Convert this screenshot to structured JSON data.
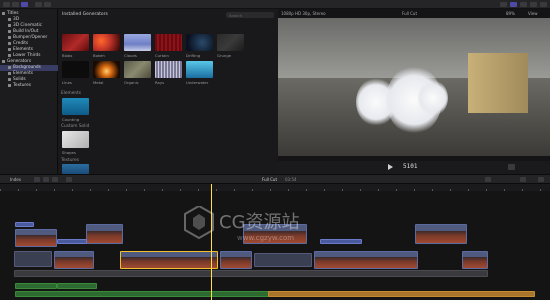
{
  "browser": {
    "title": "Installed Generators",
    "search_placeholder": "Search"
  },
  "sidebar": {
    "items": [
      {
        "label": "Titles",
        "selected": false
      },
      {
        "label": "3D",
        "selected": false
      },
      {
        "label": "3D Cinematic",
        "selected": false
      },
      {
        "label": "Build In/Out",
        "selected": false
      },
      {
        "label": "Bumper/Opener",
        "selected": false
      },
      {
        "label": "Credits",
        "selected": false
      },
      {
        "label": "Elements",
        "selected": false
      },
      {
        "label": "Lower Thirds",
        "selected": false
      },
      {
        "label": "Generators",
        "selected": false
      },
      {
        "label": "Backgrounds",
        "selected": true
      },
      {
        "label": "Elements",
        "selected": false
      },
      {
        "label": "Solids",
        "selected": false
      },
      {
        "label": "Textures",
        "selected": false
      }
    ]
  },
  "generators": {
    "row1": [
      {
        "label": "Blobs",
        "color": "#9b1f22"
      },
      {
        "label": "Bokeh",
        "color": "#c8372a"
      },
      {
        "label": "Clouds",
        "color": "#7f8fd0"
      },
      {
        "label": "Curtain",
        "color": "#7a0f15"
      },
      {
        "label": "Drifting",
        "color": "#1a2a48"
      },
      {
        "label": "Grunge",
        "color": "#2a2a2a"
      }
    ],
    "row2": [
      {
        "label": "Lines",
        "color": "#0e0e0e"
      },
      {
        "label": "Metal",
        "color": "#d6d6d6"
      },
      {
        "label": "Organic",
        "color": "#3a7a3a"
      },
      {
        "label": "Rays",
        "color": "#bdbdd8"
      },
      {
        "label": "Underwater",
        "color": "#2f9ec0"
      }
    ],
    "section_elements": "Elements",
    "counting_label": "Counting",
    "section_solids": "Custom Solid",
    "shapes_label": "Shapes",
    "section_textures": "Textures"
  },
  "viewer": {
    "title": "1080p HD 30p, Stereo",
    "clip_name": "Full Cut",
    "zoom": "89%",
    "view": "View",
    "timecode": "5101"
  },
  "timeline": {
    "index_label": "Index",
    "project_name": "Full Cut",
    "duration": "03:54"
  }
}
